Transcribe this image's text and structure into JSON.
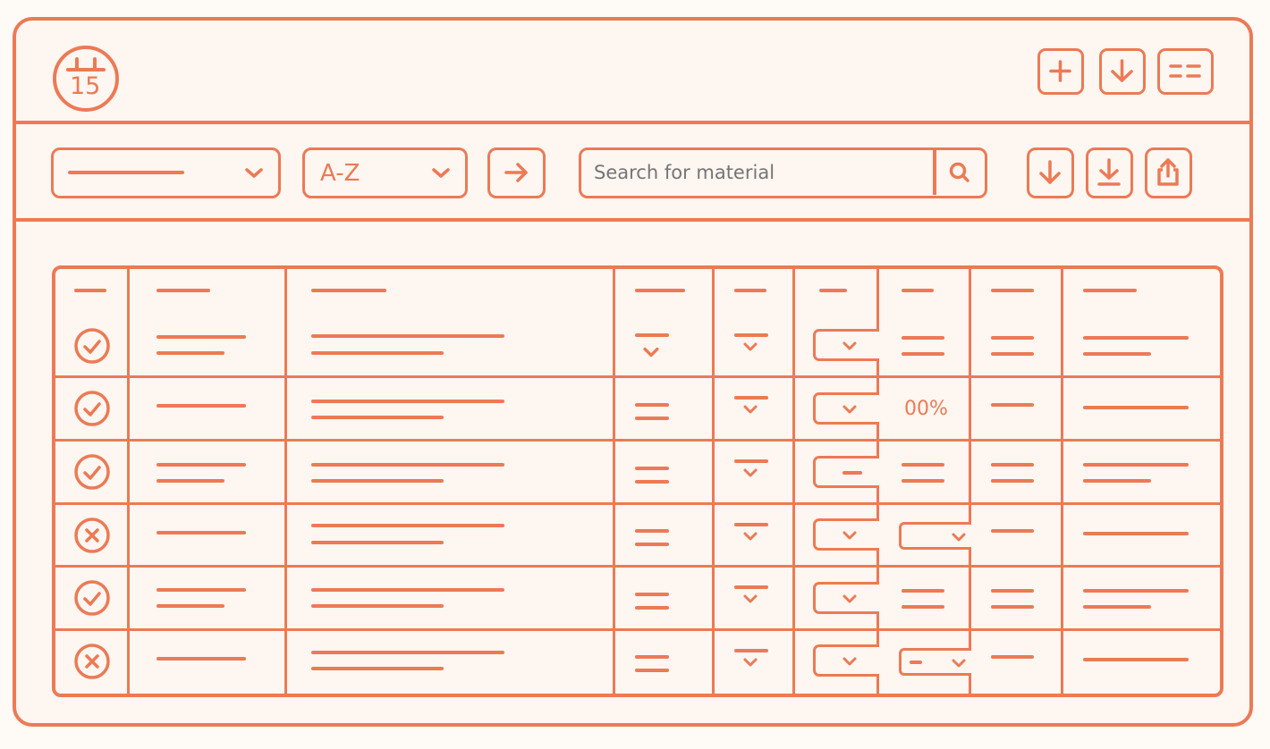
{
  "app": {
    "logo_icon": "calendar-15-icon",
    "logo_number": "15",
    "accent_color": "#ec7a55",
    "background_color": "#fdf6f1"
  },
  "titlebar": {
    "buttons": [
      {
        "name": "add-button",
        "icon": "plus-icon"
      },
      {
        "name": "download-button",
        "icon": "arrow-down-icon"
      },
      {
        "name": "view-toggle-button",
        "icon": "list-icon"
      }
    ]
  },
  "toolbar": {
    "filter_select": {
      "value": "",
      "icon": "chevron-down-icon"
    },
    "sort_select": {
      "value": "A-Z",
      "icon": "chevron-down-icon"
    },
    "apply_button_icon": "arrow-right-icon",
    "search": {
      "placeholder": "Search for material",
      "icon": "search-icon"
    },
    "actions": [
      {
        "name": "download-action-button",
        "icon": "arrow-down-icon"
      },
      {
        "name": "save-action-button",
        "icon": "download-tray-icon"
      },
      {
        "name": "export-action-button",
        "icon": "share-icon"
      }
    ]
  },
  "table": {
    "rows": [
      {
        "status": "ok",
        "status_icon": "check-circle-icon",
        "percent": ""
      },
      {
        "status": "ok",
        "status_icon": "check-circle-icon",
        "percent": "00%"
      },
      {
        "status": "ok",
        "status_icon": "check-circle-icon",
        "percent": ""
      },
      {
        "status": "error",
        "status_icon": "x-circle-icon",
        "percent": ""
      },
      {
        "status": "ok",
        "status_icon": "check-circle-icon",
        "percent": ""
      },
      {
        "status": "error",
        "status_icon": "x-circle-icon",
        "percent": ""
      }
    ]
  }
}
